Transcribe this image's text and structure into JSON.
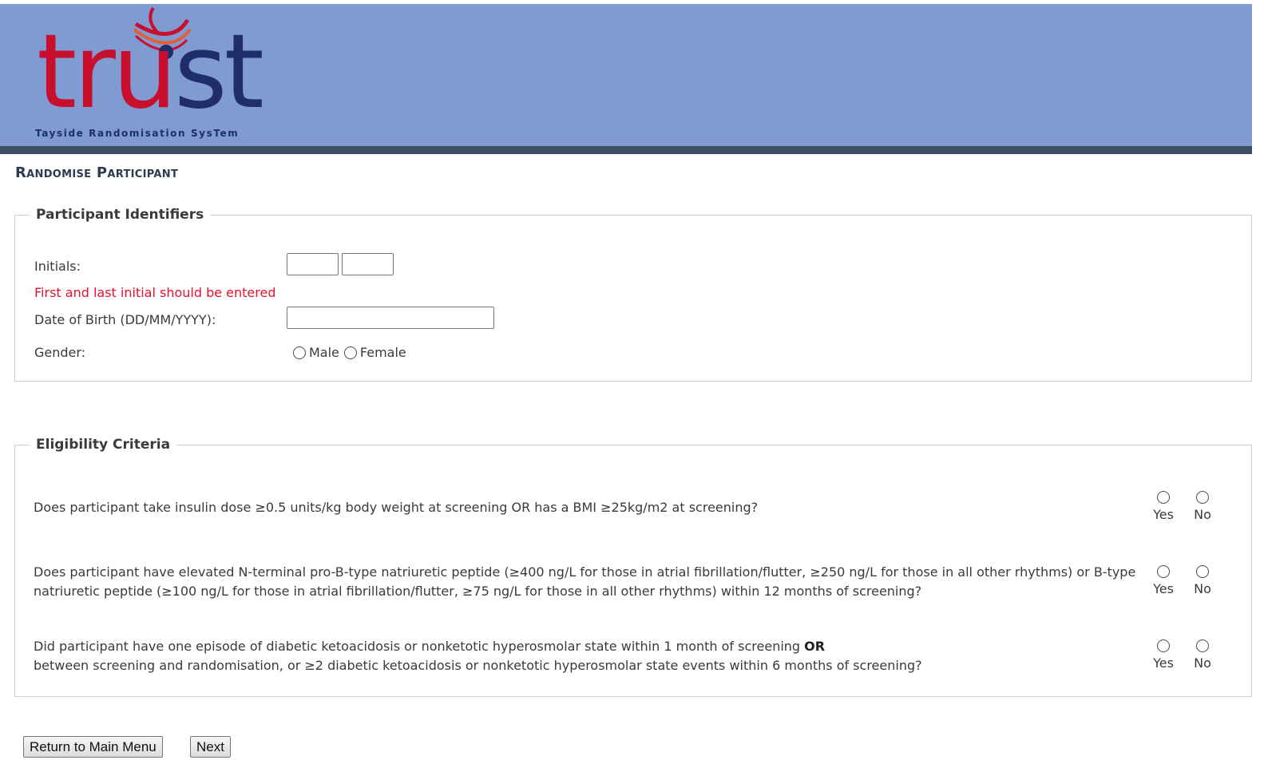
{
  "logo": {
    "text_red": "tr",
    "text_i": "u",
    "text_blue": "st",
    "tagline": "Tayside Randomisation SysTem"
  },
  "page_title": "Randomise Participant",
  "identifiers": {
    "legend": "Participant Identifiers",
    "initials_label": "Initials:",
    "initials_first_value": "",
    "initials_last_value": "",
    "initials_error": "First and last initial should be entered",
    "dob_label": "Date of Birth (DD/MM/YYYY):",
    "dob_value": "",
    "gender_label": "Gender:",
    "gender_options": [
      "Male",
      "Female"
    ]
  },
  "eligibility": {
    "legend": "Eligibility Criteria",
    "yes_label": "Yes",
    "no_label": "No",
    "questions": [
      {
        "text": "Does participant take insulin dose ≥0.5 units/kg body weight at screening OR has a BMI ≥25kg/m2 at screening?"
      },
      {
        "text": "Does participant have elevated N-terminal pro-B-type natriuretic peptide (≥400 ng/L for those in atrial fibrillation/flutter, ≥250 ng/L for those in all other rhythms) or B-type natriuretic peptide (≥100 ng/L for those in atrial fibrillation/flutter, ≥75 ng/L for those in all other rhythms) within 12 months of screening?"
      },
      {
        "text_before": "Did participant have one episode of diabetic ketoacidosis or nonketotic hyperosmolar state within 1 month of screening ",
        "text_bold": "OR",
        "text_after": "between screening and randomisation, or ≥2 diabetic ketoacidosis or nonketotic hyperosmolar state events within 6 months of screening?"
      }
    ]
  },
  "buttons": {
    "return_label": "Return to Main Menu",
    "next_label": "Next"
  },
  "colors": {
    "header_bg": "#7f9bd2",
    "header_bar": "#3e4e61",
    "logo_red": "#c8102e",
    "logo_blue": "#1f2d6b",
    "error_red": "#e8102e"
  }
}
